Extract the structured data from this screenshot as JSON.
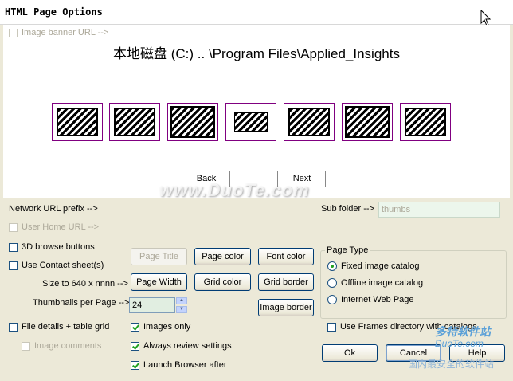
{
  "window": {
    "title": "HTML Page Options"
  },
  "preview": {
    "banner_checkbox": "Image banner URL -->",
    "path": "本地磁盘 (C:) .. \\Program Files\\Applied_Insights",
    "back": "Back",
    "next": "Next",
    "thumbnail_count": 7
  },
  "labels": {
    "network_url": "Network URL prefix -->",
    "sub_folder": "Sub folder -->",
    "size_to": "Size to 640 x nnnn -->",
    "thumbs_per_page": "Thumbnails per Page -->"
  },
  "inputs": {
    "sub_folder_value": "thumbs",
    "thumbs_per_page_value": "24"
  },
  "checkboxes": {
    "user_home": "User Home URL -->",
    "browse_buttons": "3D browse buttons",
    "contact_sheets": "Use Contact sheet(s)",
    "file_details": "File details + table grid",
    "image_comments": "Image comments",
    "images_only": "Images only",
    "always_review": "Always review settings",
    "launch_browser": "Launch Browser after",
    "use_frames": "Use Frames directory with catalogs"
  },
  "buttons": {
    "page_title": "Page Title",
    "page_color": "Page color",
    "font_color": "Font color",
    "page_width": "Page Width",
    "grid_color": "Grid color",
    "grid_border": "Grid border",
    "image_border": "Image border",
    "ok": "Ok",
    "cancel": "Cancel",
    "help": "Help"
  },
  "page_type": {
    "title": "Page Type",
    "options": [
      "Fixed image catalog",
      "Offline image catalog",
      "Internet Web Page"
    ],
    "selected": "Fixed image catalog"
  },
  "watermarks": {
    "main": "www.DuoTe.com",
    "brand": "多特软件站",
    "brand_url": "DuoTe.com",
    "tagline": "国内最安全的软件站"
  }
}
